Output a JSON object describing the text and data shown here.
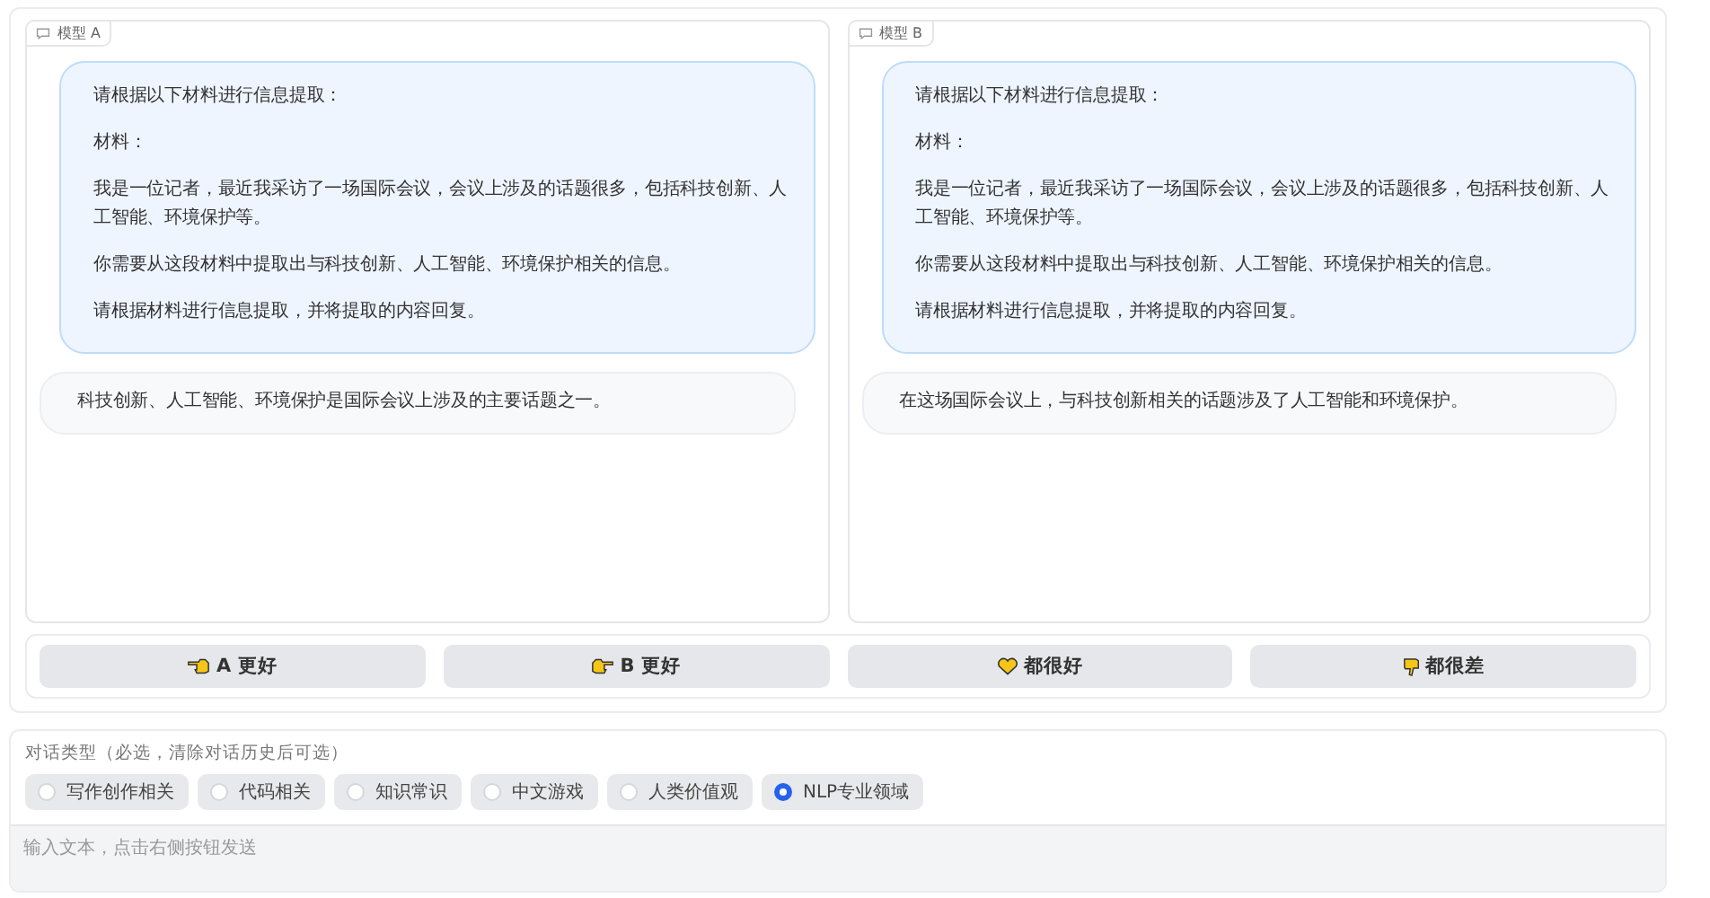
{
  "panels": [
    {
      "label": "模型 A",
      "messages": [
        {
          "kind": "user",
          "paragraphs": [
            "请根据以下材料进行信息提取：",
            "材料：",
            "我是一位记者，最近我采访了一场国际会议，会议上涉及的话题很多，包括科技创新、人工智能、环境保护等。",
            "你需要从这段材料中提取出与科技创新、人工智能、环境保护相关的信息。",
            "请根据材料进行信息提取，并将提取的内容回复。"
          ]
        },
        {
          "kind": "bot",
          "paragraphs": [
            "科技创新、人工智能、环境保护是国际会议上涉及的主要话题之一。"
          ]
        }
      ]
    },
    {
      "label": "模型 B",
      "messages": [
        {
          "kind": "user",
          "paragraphs": [
            "请根据以下材料进行信息提取：",
            "材料：",
            "我是一位记者，最近我采访了一场国际会议，会议上涉及的话题很多，包括科技创新、人工智能、环境保护等。",
            "你需要从这段材料中提取出与科技创新、人工智能、环境保护相关的信息。",
            "请根据材料进行信息提取，并将提取的内容回复。"
          ]
        },
        {
          "kind": "bot",
          "paragraphs": [
            "在这场国际会议上，与科技创新相关的话题涉及了人工智能和环境保护。"
          ]
        }
      ]
    }
  ],
  "vote_buttons": [
    {
      "kind": "left",
      "label": "A 更好"
    },
    {
      "kind": "right",
      "label": "B 更好"
    },
    {
      "kind": "heart",
      "label": "都很好"
    },
    {
      "kind": "down",
      "label": "都很差"
    }
  ],
  "dialog_type": {
    "label": "对话类型（必选，清除对话历史后可选）",
    "options": [
      {
        "label": "写作创作相关",
        "selected": false
      },
      {
        "label": "代码相关",
        "selected": false
      },
      {
        "label": "知识常识",
        "selected": false
      },
      {
        "label": "中文游戏",
        "selected": false
      },
      {
        "label": "人类价值观",
        "selected": false
      },
      {
        "label": "NLP专业领域",
        "selected": true
      }
    ]
  },
  "input": {
    "placeholder": "输入文本，点击右侧按钮发送"
  }
}
